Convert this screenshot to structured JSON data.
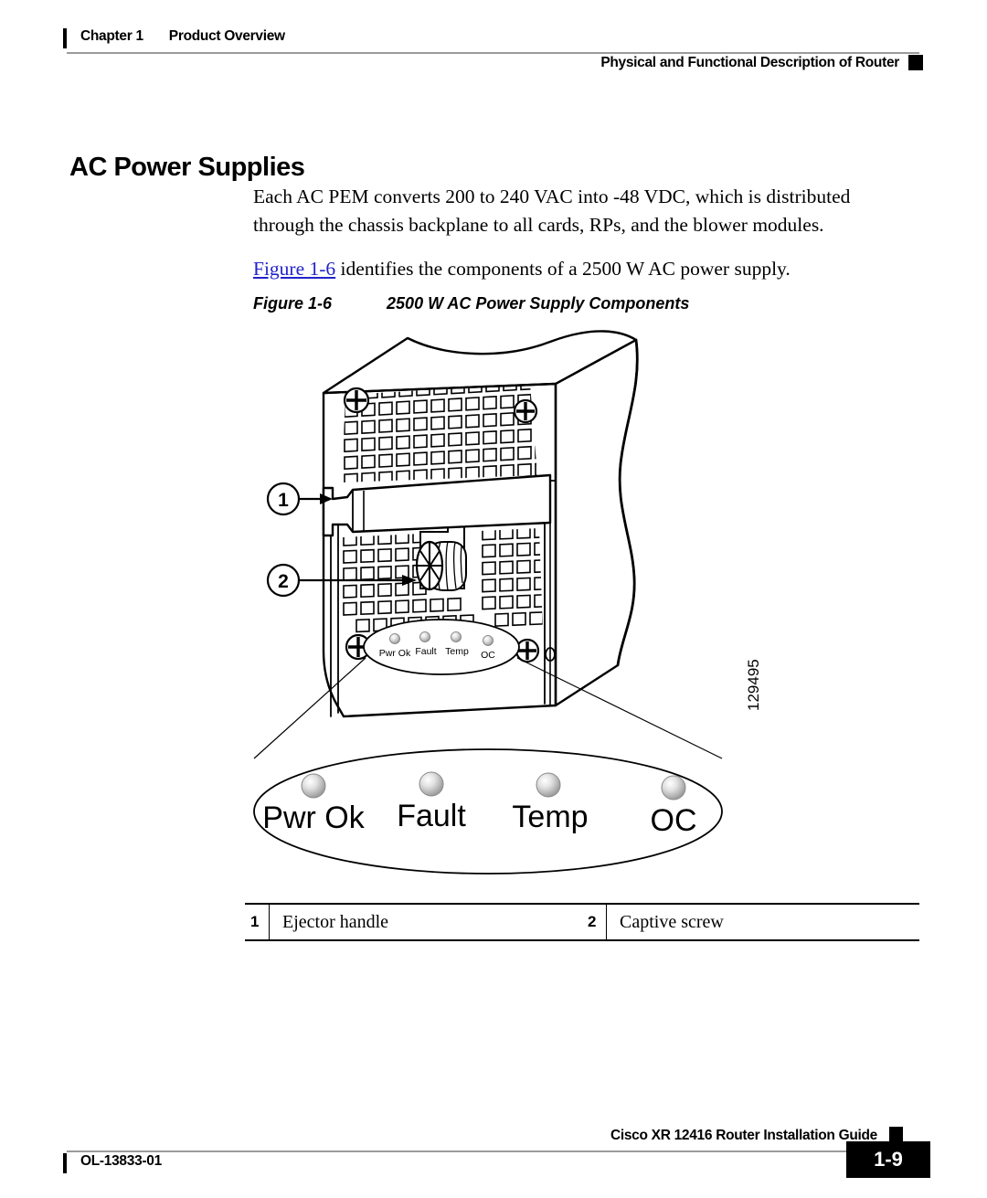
{
  "header": {
    "chapter_label": "Chapter 1",
    "chapter_title": "Product Overview",
    "running_head": "Physical and Functional Description of Router"
  },
  "section": {
    "heading": "AC Power Supplies"
  },
  "body": {
    "paragraph_1": "Each AC PEM converts 200 to 240 VAC into -48 VDC, which is distributed through the chassis backplane to all cards, RPs, and the blower modules.",
    "paragraph_2_link": "Figure 1-6",
    "paragraph_2_rest": " identifies the components of a 2500 W AC power supply."
  },
  "figure": {
    "caption_number": "Figure 1-6",
    "caption_title": "2500 W AC Power Supply Components",
    "art_id": "129495",
    "callouts": [
      {
        "number": "1",
        "target": "ejector-handle"
      },
      {
        "number": "2",
        "target": "captive-screw"
      }
    ],
    "leds_small": [
      "Pwr Ok",
      "Fault",
      "Temp",
      "OC"
    ],
    "leds_magnified": [
      "Pwr Ok",
      "Fault",
      "Temp",
      "OC"
    ]
  },
  "legend": {
    "rows": [
      {
        "number": "1",
        "label": "Ejector handle"
      },
      {
        "number": "2",
        "label": "Captive screw"
      }
    ]
  },
  "footer": {
    "doc_id": "OL-13833-01",
    "guide_title": "Cisco XR 12416 Router Installation Guide",
    "page_number": "1-9"
  },
  "colors": {
    "link": "#2222cc",
    "rule": "#9b9b9b",
    "ink": "#000000",
    "led_body": "#cfcfcf",
    "led_highlight": "#ffffff"
  }
}
